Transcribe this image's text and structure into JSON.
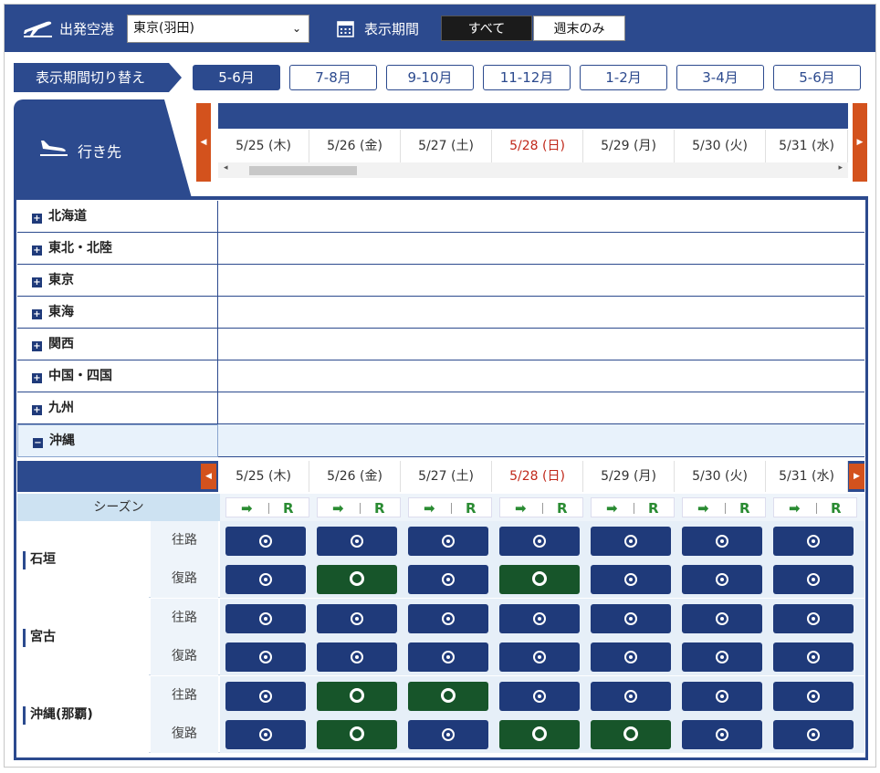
{
  "header": {
    "departure_label": "出発空港",
    "departure_value": "東京(羽田)",
    "period_label": "表示期間",
    "period_all": "すべて",
    "period_weekend": "週末のみ"
  },
  "period_switch": {
    "label": "表示期間切り替え",
    "tabs": [
      "5-6月",
      "7-8月",
      "9-10月",
      "11-12月",
      "1-2月",
      "3-4月",
      "5-6月"
    ],
    "active_index": 0
  },
  "destination_header": "行き先",
  "dates": [
    {
      "label": "5/25 (木)",
      "holiday": false
    },
    {
      "label": "5/26 (金)",
      "holiday": false
    },
    {
      "label": "5/27 (土)",
      "holiday": false
    },
    {
      "label": "5/28 (日)",
      "holiday": true
    },
    {
      "label": "5/29 (月)",
      "holiday": false
    },
    {
      "label": "5/30 (火)",
      "holiday": false
    },
    {
      "label": "5/31 (水)",
      "holiday": false
    }
  ],
  "regions": [
    {
      "name": "北海道",
      "expanded": false
    },
    {
      "name": "東北・北陸",
      "expanded": false
    },
    {
      "name": "東京",
      "expanded": false
    },
    {
      "name": "東海",
      "expanded": false
    },
    {
      "name": "関西",
      "expanded": false
    },
    {
      "name": "中国・四国",
      "expanded": false
    },
    {
      "name": "九州",
      "expanded": false
    },
    {
      "name": "沖縄",
      "expanded": true
    }
  ],
  "season_label": "シーズン",
  "season_arrow": "➡",
  "season_r": "R",
  "direction_labels": {
    "outbound": "往路",
    "return": "復路"
  },
  "colors": {
    "brand_blue": "#2c4a8e",
    "seat_normal": "#1f3a7a",
    "seat_green": "#17552a",
    "nav_orange": "#d3521d",
    "holiday_red": "#c0281a"
  },
  "okinawa_destinations": [
    {
      "name": "石垣",
      "outbound": [
        "dot",
        "dot",
        "dot",
        "dot",
        "dot",
        "dot",
        "dot"
      ],
      "return": [
        "dot",
        "ring",
        "dot",
        "ring",
        "dot",
        "dot",
        "dot"
      ]
    },
    {
      "name": "宮古",
      "outbound": [
        "dot",
        "dot",
        "dot",
        "dot",
        "dot",
        "dot",
        "dot"
      ],
      "return": [
        "dot",
        "dot",
        "dot",
        "dot",
        "dot",
        "dot",
        "dot"
      ]
    },
    {
      "name": "沖縄(那覇)",
      "outbound": [
        "dot",
        "ring",
        "ring",
        "dot",
        "dot",
        "dot",
        "dot"
      ],
      "return": [
        "dot",
        "ring",
        "dot",
        "ring",
        "ring",
        "dot",
        "dot"
      ]
    }
  ]
}
